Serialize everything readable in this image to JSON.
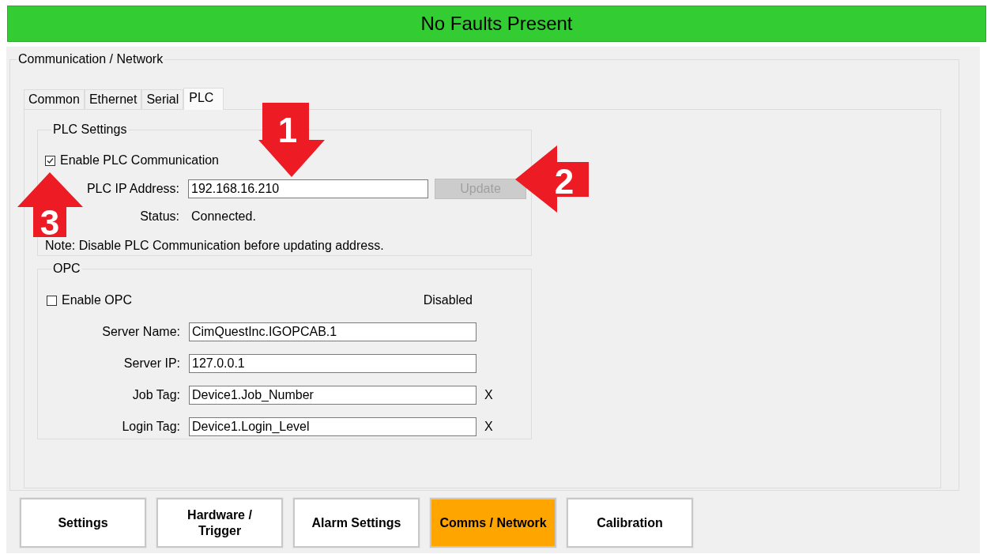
{
  "status_banner": "No Faults Present",
  "panel": {
    "title": "Communication / Network"
  },
  "tabs": [
    {
      "label": "Common",
      "selected": false
    },
    {
      "label": "Ethernet",
      "selected": false
    },
    {
      "label": "Serial",
      "selected": false
    },
    {
      "label": "PLC",
      "selected": true
    }
  ],
  "plc_settings": {
    "title": "PLC Settings",
    "enable": {
      "label": "Enable PLC Communication",
      "checked": true
    },
    "ip": {
      "label": "PLC IP Address:",
      "value": "192.168.16.210"
    },
    "update_button": {
      "label": "Update",
      "disabled": true
    },
    "status": {
      "label": "Status:",
      "value": "Connected."
    },
    "note": "Note: Disable PLC Communication before updating address."
  },
  "opc": {
    "title": "OPC",
    "enable": {
      "label": "Enable OPC",
      "checked": false
    },
    "state": "Disabled",
    "fields": [
      {
        "label": "Server Name:",
        "value": "CimQuestInc.IGOPCAB.1"
      },
      {
        "label": "Server IP:",
        "value": "127.0.0.1"
      },
      {
        "label": "Job Tag:",
        "value": "Device1.Job_Number",
        "marker": "X"
      },
      {
        "label": "Login Tag:",
        "value": "Device1.Login_Level",
        "marker": "X"
      }
    ]
  },
  "nav_buttons": [
    {
      "label": "Settings",
      "selected": false
    },
    {
      "label": "Hardware /\nTrigger",
      "selected": false
    },
    {
      "label": "Alarm Settings",
      "selected": false
    },
    {
      "label": "Comms / Network",
      "selected": true
    },
    {
      "label": "Calibration",
      "selected": false
    }
  ],
  "callouts": [
    {
      "number": "1",
      "kind": "down"
    },
    {
      "number": "2",
      "kind": "left"
    },
    {
      "number": "3",
      "kind": "up"
    }
  ]
}
